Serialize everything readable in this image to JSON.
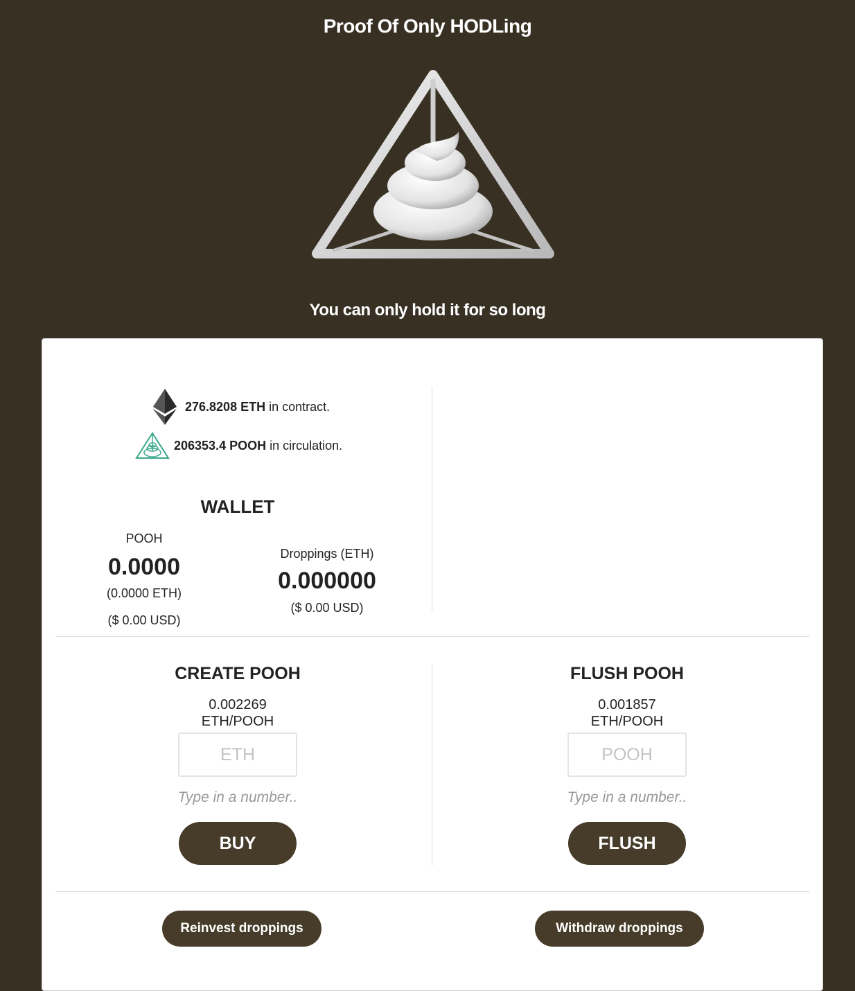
{
  "header": {
    "title": "Proof Of Only HODLing",
    "tagline": "You can only hold it for so long"
  },
  "stats": {
    "eth_value": "276.8208 ETH",
    "eth_suffix": "in contract.",
    "pooh_value": "206353.4 POOH",
    "pooh_suffix": "in circulation."
  },
  "wallet": {
    "title": "WALLET",
    "pooh_label": "POOH",
    "pooh_amount": "0.0000",
    "pooh_eth": "(0.0000 ETH)",
    "pooh_usd": "($ 0.00 USD)",
    "droppings_label": "Droppings (ETH)",
    "droppings_amount": "0.000000",
    "droppings_usd": "($ 0.00 USD)"
  },
  "create": {
    "title": "CREATE POOH",
    "rate_value": "0.002269",
    "rate_unit": "ETH/POOH",
    "input_placeholder": "ETH",
    "hint": "Type in a number..",
    "button_label": "BUY"
  },
  "flush": {
    "title": "FLUSH POOH",
    "rate_value": "0.001857",
    "rate_unit": "ETH/POOH",
    "input_placeholder": "POOH",
    "hint": "Type in a number..",
    "button_label": "FLUSH"
  },
  "actions": {
    "reinvest_label": "Reinvest droppings",
    "withdraw_label": "Withdraw droppings"
  },
  "colors": {
    "background": "#383023",
    "button": "#463c29",
    "pooh_icon": "#3aa88a"
  }
}
